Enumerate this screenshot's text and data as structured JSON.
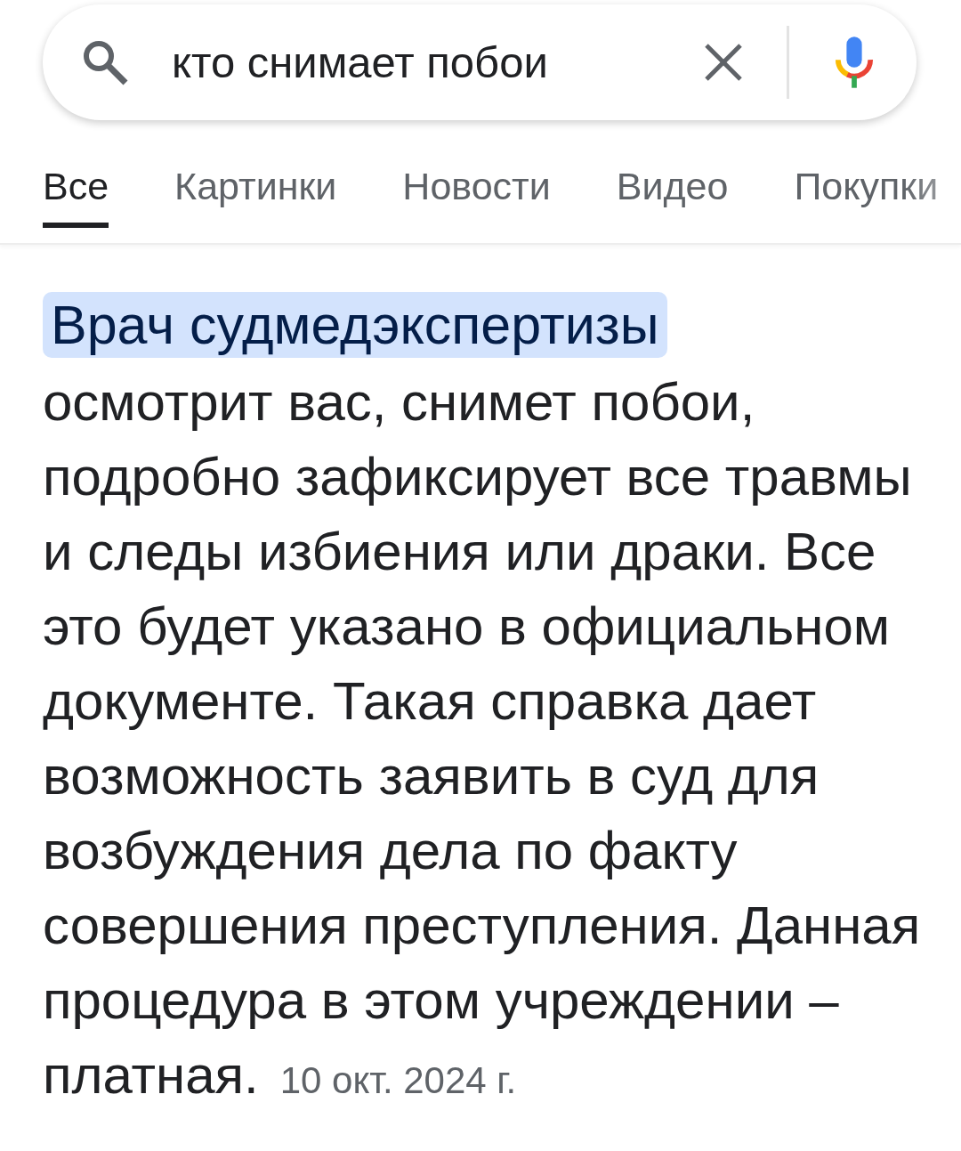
{
  "search": {
    "value": "кто снимает побои"
  },
  "tabs": [
    {
      "label": "Все",
      "selected": true
    },
    {
      "label": "Картинки",
      "selected": false
    },
    {
      "label": "Новости",
      "selected": false
    },
    {
      "label": "Видео",
      "selected": false
    },
    {
      "label": "Покупки",
      "selected": false
    }
  ],
  "snippet": {
    "highlight": "Врач судмедэкспертизы",
    "text": "осмотрит вас, снимет побои, подробно зафиксирует все травмы и следы избиения или драки. Все это будет указано в официальном документе. Такая справка дает возможность заявить в суд для возбуждения дела по факту совершения преступления. Данная процедура в этом учреждении – платная.",
    "date": "10 окт. 2024 г."
  }
}
